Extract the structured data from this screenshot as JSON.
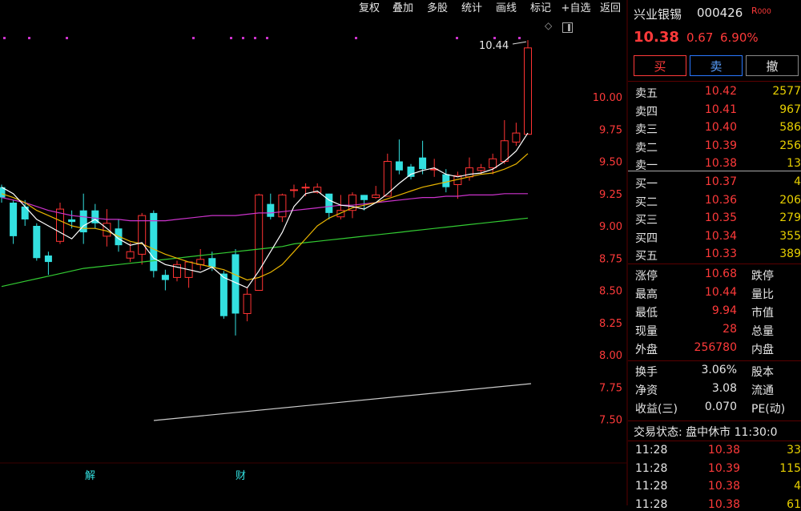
{
  "toolbar": {
    "items": [
      "复权",
      "叠加",
      "多股",
      "统计",
      "画线",
      "标记",
      "+自选",
      "返回"
    ]
  },
  "stock": {
    "name": "兴业银锡",
    "code": "000426",
    "tag": "R",
    "tag2": "000",
    "price": "10.38",
    "change": "0.67",
    "pct": "6.90%"
  },
  "actions": {
    "buy": "买",
    "sell": "卖",
    "cancel": "撤"
  },
  "orderbook": {
    "asks": [
      {
        "label": "卖五",
        "price": "10.42",
        "vol": "2577"
      },
      {
        "label": "卖四",
        "price": "10.41",
        "vol": "967"
      },
      {
        "label": "卖三",
        "price": "10.40",
        "vol": "586"
      },
      {
        "label": "卖二",
        "price": "10.39",
        "vol": "256"
      },
      {
        "label": "卖一",
        "price": "10.38",
        "vol": "13"
      }
    ],
    "bids": [
      {
        "label": "买一",
        "price": "10.37",
        "vol": "4"
      },
      {
        "label": "买二",
        "price": "10.36",
        "vol": "206"
      },
      {
        "label": "买三",
        "price": "10.35",
        "vol": "279"
      },
      {
        "label": "买四",
        "price": "10.34",
        "vol": "355"
      },
      {
        "label": "买五",
        "price": "10.33",
        "vol": "389"
      }
    ]
  },
  "stats": [
    {
      "l1": "涨停",
      "v1": "10.68",
      "l2": "跌停"
    },
    {
      "l1": "最高",
      "v1": "10.44",
      "l2": "量比"
    },
    {
      "l1": "最低",
      "v1": "9.94",
      "l2": "市值"
    },
    {
      "l1": "现量",
      "v1": "28",
      "l2": "总量"
    },
    {
      "l1": "外盘",
      "v1": "256780",
      "l2": "内盘"
    }
  ],
  "stats2": [
    {
      "l1": "换手",
      "v1": "3.06%",
      "l2": "股本"
    },
    {
      "l1": "净资",
      "v1": "3.08",
      "l2": "流通"
    },
    {
      "l1": "收益(三)",
      "v1": "0.070",
      "l2": "PE(动)"
    }
  ],
  "trade_status": "交易状态: 盘中休市 11:30:0",
  "ticks": [
    {
      "time": "11:28",
      "price": "10.38",
      "vol": "33"
    },
    {
      "time": "11:28",
      "price": "10.39",
      "vol": "115"
    },
    {
      "time": "11:28",
      "price": "10.38",
      "vol": "4"
    },
    {
      "time": "11:28",
      "price": "10.38",
      "vol": "61"
    }
  ],
  "markers": {
    "jie": "解",
    "cai": "财"
  },
  "chart_data": {
    "type": "candlestick",
    "y_ticks": [
      "10.00",
      "9.75",
      "9.50",
      "9.25",
      "9.00",
      "8.75",
      "8.50",
      "8.25",
      "8.00",
      "7.75",
      "7.50"
    ],
    "ylim": [
      7.5,
      10.0
    ],
    "high_label": "10.44",
    "colors": {
      "up": "#ff3333",
      "down": "#33e0e0",
      "ma5": "#ffffff",
      "ma10": "#e8b400",
      "ma20": "#cc33cc",
      "ma60": "#33cc33",
      "ma250": "#cccccc"
    },
    "candles": [
      {
        "o": 9.3,
        "c": 9.22,
        "h": 9.32,
        "l": 9.18
      },
      {
        "o": 9.18,
        "c": 8.92,
        "h": 9.2,
        "l": 8.86
      },
      {
        "o": 9.15,
        "c": 9.05,
        "h": 9.2,
        "l": 9.0
      },
      {
        "o": 9.0,
        "c": 8.75,
        "h": 9.02,
        "l": 8.73
      },
      {
        "o": 8.77,
        "c": 8.72,
        "h": 8.8,
        "l": 8.62
      },
      {
        "o": 8.88,
        "c": 9.13,
        "h": 9.18,
        "l": 8.86
      },
      {
        "o": 9.05,
        "c": 9.03,
        "h": 9.12,
        "l": 8.98
      },
      {
        "o": 9.12,
        "c": 8.95,
        "h": 9.25,
        "l": 8.86
      },
      {
        "o": 9.12,
        "c": 9.02,
        "h": 9.17,
        "l": 8.98
      },
      {
        "o": 8.92,
        "c": 9.02,
        "h": 9.13,
        "l": 8.84
      },
      {
        "o": 8.98,
        "c": 8.85,
        "h": 9.05,
        "l": 8.8
      },
      {
        "o": 8.75,
        "c": 8.8,
        "h": 8.87,
        "l": 8.72
      },
      {
        "o": 8.78,
        "c": 9.08,
        "h": 9.1,
        "l": 8.7
      },
      {
        "o": 9.1,
        "c": 8.65,
        "h": 9.12,
        "l": 8.6
      },
      {
        "o": 8.62,
        "c": 8.58,
        "h": 8.66,
        "l": 8.5
      },
      {
        "o": 8.6,
        "c": 8.7,
        "h": 8.73,
        "l": 8.57
      },
      {
        "o": 8.6,
        "c": 8.72,
        "h": 8.72,
        "l": 8.52
      },
      {
        "o": 8.7,
        "c": 8.74,
        "h": 8.82,
        "l": 8.66
      },
      {
        "o": 8.75,
        "c": 8.68,
        "h": 8.8,
        "l": 8.65
      },
      {
        "o": 8.63,
        "c": 8.3,
        "h": 8.65,
        "l": 8.28
      },
      {
        "o": 8.78,
        "c": 8.32,
        "h": 8.82,
        "l": 8.15
      },
      {
        "o": 8.32,
        "c": 8.47,
        "h": 8.52,
        "l": 8.26
      },
      {
        "o": 8.5,
        "c": 9.24,
        "h": 9.25,
        "l": 8.5
      },
      {
        "o": 9.17,
        "c": 9.07,
        "h": 9.25,
        "l": 9.05
      },
      {
        "o": 9.07,
        "c": 9.24,
        "h": 9.25,
        "l": 9.03
      },
      {
        "o": 9.28,
        "c": 9.28,
        "h": 9.32,
        "l": 9.22
      },
      {
        "o": 9.3,
        "c": 9.3,
        "h": 9.33,
        "l": 9.23
      },
      {
        "o": 9.26,
        "c": 9.3,
        "h": 9.33,
        "l": 9.25
      },
      {
        "o": 9.25,
        "c": 9.1,
        "h": 9.25,
        "l": 9.05
      },
      {
        "o": 9.07,
        "c": 9.12,
        "h": 9.24,
        "l": 9.05
      },
      {
        "o": 9.12,
        "c": 9.24,
        "h": 9.26,
        "l": 9.06
      },
      {
        "o": 9.24,
        "c": 9.2,
        "h": 9.24,
        "l": 9.12
      },
      {
        "o": 9.22,
        "c": 9.24,
        "h": 9.31,
        "l": 9.21
      },
      {
        "o": 9.23,
        "c": 9.5,
        "h": 9.56,
        "l": 9.23
      },
      {
        "o": 9.5,
        "c": 9.43,
        "h": 9.67,
        "l": 9.4
      },
      {
        "o": 9.46,
        "c": 9.38,
        "h": 9.48,
        "l": 9.36
      },
      {
        "o": 9.53,
        "c": 9.44,
        "h": 9.66,
        "l": 9.4
      },
      {
        "o": 9.44,
        "c": 9.44,
        "h": 9.52,
        "l": 9.38
      },
      {
        "o": 9.4,
        "c": 9.3,
        "h": 9.44,
        "l": 9.26
      },
      {
        "o": 9.32,
        "c": 9.39,
        "h": 9.42,
        "l": 9.21
      },
      {
        "o": 9.38,
        "c": 9.45,
        "h": 9.53,
        "l": 9.35
      },
      {
        "o": 9.43,
        "c": 9.45,
        "h": 9.48,
        "l": 9.4
      },
      {
        "o": 9.45,
        "c": 9.52,
        "h": 9.56,
        "l": 9.4
      },
      {
        "o": 9.5,
        "c": 9.66,
        "h": 9.82,
        "l": 9.48
      },
      {
        "o": 9.65,
        "c": 9.72,
        "h": 9.8,
        "l": 9.62
      },
      {
        "o": 9.71,
        "c": 10.38,
        "h": 10.44,
        "l": 9.94
      }
    ],
    "ma5": [
      9.3,
      9.25,
      9.15,
      9.05,
      9.0,
      8.95,
      8.9,
      9.0,
      9.05,
      8.98,
      8.9,
      8.85,
      8.87,
      8.75,
      8.7,
      8.68,
      8.66,
      8.64,
      8.68,
      8.6,
      8.56,
      8.52,
      8.65,
      8.8,
      8.95,
      9.15,
      9.25,
      9.27,
      9.2,
      9.16,
      9.15,
      9.13,
      9.18,
      9.25,
      9.33,
      9.4,
      9.43,
      9.45,
      9.4,
      9.38,
      9.4,
      9.41,
      9.44,
      9.5,
      9.58,
      9.72
    ],
    "ma10": [
      9.25,
      9.22,
      9.18,
      9.12,
      9.08,
      9.04,
      9.0,
      8.98,
      8.98,
      8.96,
      8.92,
      8.88,
      8.86,
      8.82,
      8.78,
      8.75,
      8.72,
      8.7,
      8.68,
      8.66,
      8.62,
      8.58,
      8.6,
      8.64,
      8.7,
      8.8,
      8.9,
      9.0,
      9.06,
      9.1,
      9.14,
      9.16,
      9.18,
      9.21,
      9.24,
      9.27,
      9.3,
      9.32,
      9.34,
      9.36,
      9.38,
      9.4,
      9.41,
      9.44,
      9.48,
      9.56
    ],
    "ma20": [
      9.22,
      9.2,
      9.18,
      9.15,
      9.12,
      9.1,
      9.08,
      9.07,
      9.06,
      9.05,
      9.05,
      9.04,
      9.04,
      9.04,
      9.04,
      9.05,
      9.06,
      9.07,
      9.08,
      9.08,
      9.08,
      9.09,
      9.1,
      9.1,
      9.11,
      9.12,
      9.13,
      9.14,
      9.15,
      9.16,
      9.16,
      9.17,
      9.18,
      9.19,
      9.2,
      9.21,
      9.22,
      9.22,
      9.23,
      9.23,
      9.24,
      9.24,
      9.24,
      9.25,
      9.25,
      9.25
    ],
    "ma60": [
      8.53,
      8.55,
      8.57,
      8.59,
      8.61,
      8.63,
      8.65,
      8.67,
      8.68,
      8.69,
      8.7,
      8.71,
      8.72,
      8.73,
      8.74,
      8.75,
      8.76,
      8.77,
      8.78,
      8.79,
      8.8,
      8.81,
      8.82,
      8.83,
      8.84,
      8.86,
      8.87,
      8.88,
      8.89,
      8.9,
      8.91,
      8.92,
      8.93,
      8.94,
      8.95,
      8.96,
      8.97,
      8.98,
      8.99,
      9.0,
      9.01,
      9.02,
      9.03,
      9.04,
      9.05,
      9.06
    ],
    "ma250_start": 7.5,
    "ma250_end": 7.8
  }
}
